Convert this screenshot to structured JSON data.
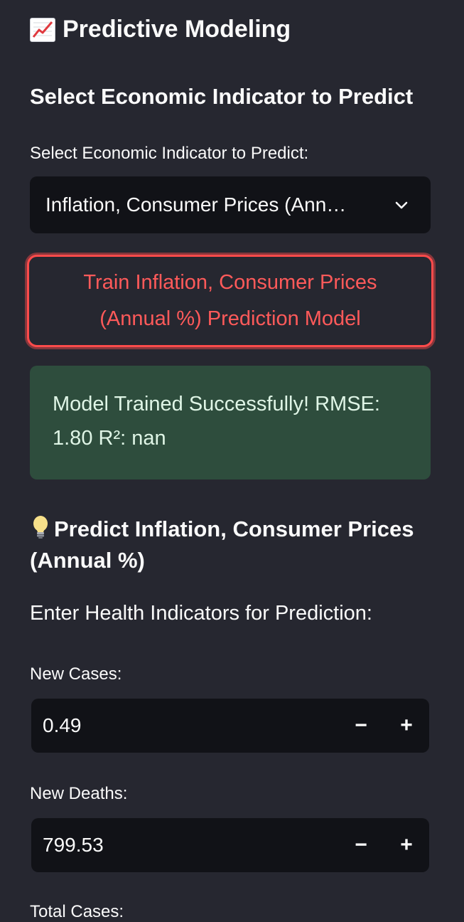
{
  "page": {
    "title": "Predictive Modeling",
    "title_icon": "chart-increasing-icon"
  },
  "indicator_section": {
    "heading": "Select Economic Indicator to Predict",
    "select_label": "Select Economic Indicator to Predict:",
    "selected_value": "Inflation, Consumer Prices (Ann…",
    "train_button_label": "Train Inflation, Consumer Prices (Annual %) Prediction Model"
  },
  "status": {
    "success_message": "Model Trained Successfully! RMSE: 1.80 R²: nan",
    "color": "#2e4d3d"
  },
  "prediction_section": {
    "heading": "Predict Inflation, Consumer Prices (Annual %)",
    "heading_icon": "light-bulb-icon",
    "instructions": "Enter Health Indicators for Prediction:",
    "inputs": [
      {
        "label": "New Cases:",
        "value": "0.49"
      },
      {
        "label": "New Deaths:",
        "value": "799.53"
      },
      {
        "label": "Total Cases:"
      }
    ],
    "decrement_symbol": "−",
    "increment_symbol": "+"
  },
  "colors": {
    "background": "#262730",
    "input_background": "#111217",
    "accent": "#ff4b4b"
  }
}
